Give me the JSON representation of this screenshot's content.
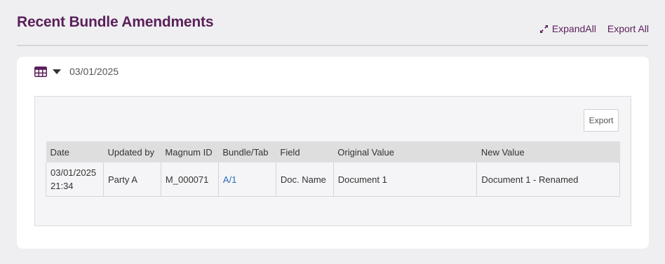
{
  "header": {
    "title": "Recent Bundle Amendments",
    "expand_all_label": "ExpandAll",
    "export_all_label": "Export All"
  },
  "snapshot": {
    "date": "03/01/2025"
  },
  "panel": {
    "export_label": "Export"
  },
  "table": {
    "columns": [
      "Date",
      "Updated by",
      "Magnum ID",
      "Bundle/Tab",
      "Field",
      "Original Value",
      "New Value"
    ],
    "rows": [
      {
        "date_line1": "03/01/2025",
        "date_line2": "21:34",
        "updated_by": "Party A",
        "magnum_id": "M_000071",
        "bundle_tab": "A/1",
        "field": "Doc. Name",
        "original_value": "Document 1",
        "new_value": "Document 1 - Renamed"
      }
    ]
  },
  "colors": {
    "brand": "#5a1f5a",
    "link": "#2a6bb5",
    "page_bg": "#efeff1",
    "header_row_bg": "#dededf"
  },
  "icons": {
    "expand": "expand-arrows-icon",
    "grid": "grid-table-icon",
    "caret": "caret-down-icon"
  }
}
